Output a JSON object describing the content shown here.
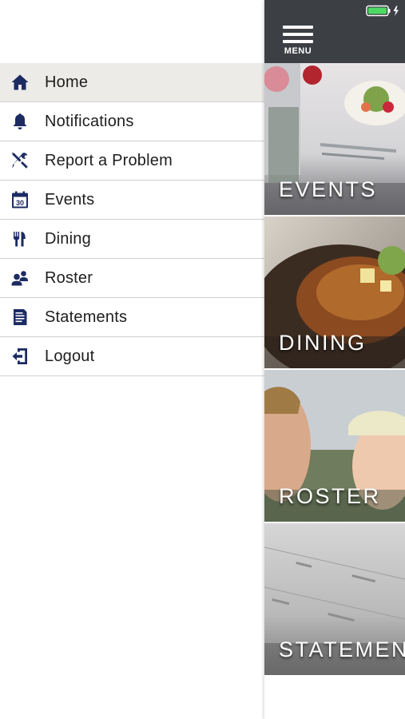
{
  "colors": {
    "icon_navy": "#1d2b63",
    "topbar": "#3c3f44",
    "active_row": "#ecebe8",
    "battery": "#4cd964"
  },
  "topbar": {
    "menu_label": "MENU"
  },
  "drawer": {
    "items": [
      {
        "label": "Home",
        "icon": "home-icon",
        "active": true
      },
      {
        "label": "Notifications",
        "icon": "bell-icon",
        "active": false
      },
      {
        "label": "Report a Problem",
        "icon": "tools-icon",
        "active": false
      },
      {
        "label": "Events",
        "icon": "calendar-icon",
        "icon_text": "30",
        "active": false
      },
      {
        "label": "Dining",
        "icon": "fork-knife-icon",
        "active": false
      },
      {
        "label": "Roster",
        "icon": "people-icon",
        "active": false
      },
      {
        "label": "Statements",
        "icon": "document-icon",
        "active": false
      },
      {
        "label": "Logout",
        "icon": "logout-icon",
        "active": false
      }
    ]
  },
  "tiles": {
    "events": "EVENTS",
    "dining": "DINING",
    "roster": "ROSTER",
    "statements": "STATEMENTS"
  }
}
